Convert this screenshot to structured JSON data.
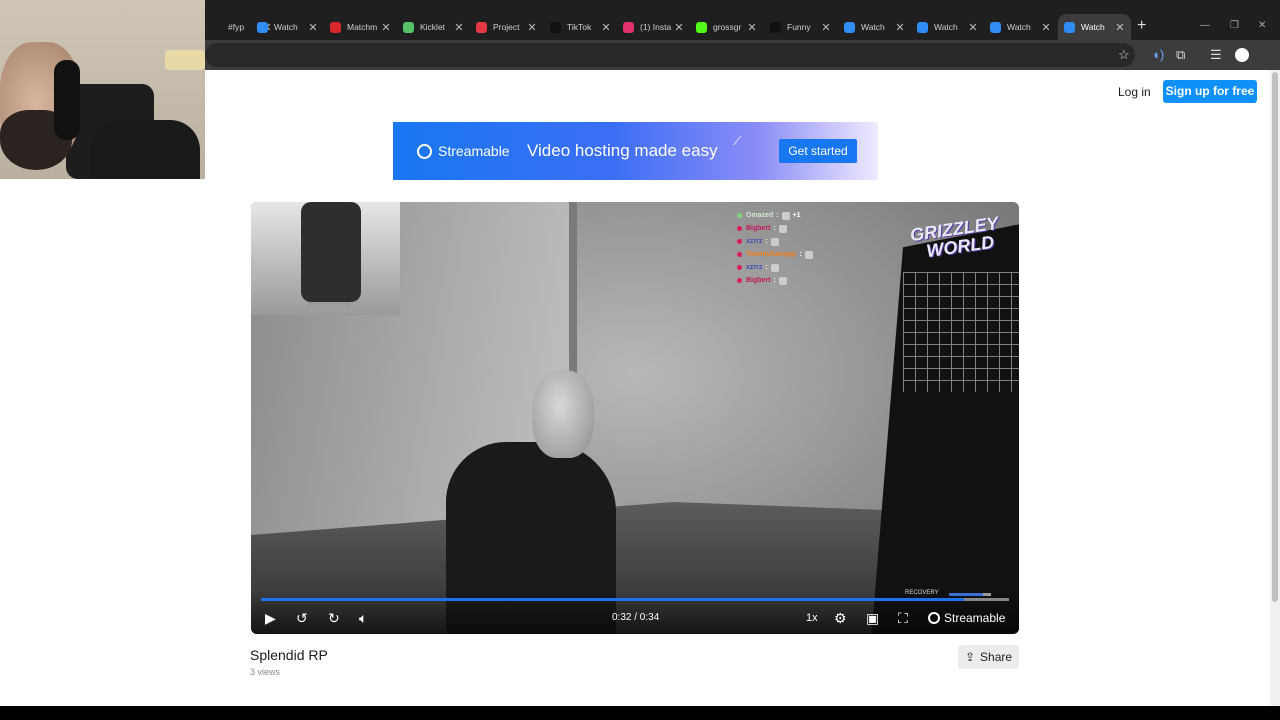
{
  "browser": {
    "tabs": [
      {
        "label": "#fyp",
        "favicon": "#1e1e1e",
        "icon": "tiktok-icon"
      },
      {
        "label": "Watch",
        "favicon": "#2f8df5",
        "icon": "streamable-icon"
      },
      {
        "label": "Matchm",
        "favicon": "#d8262d",
        "icon": "matchmaking-icon"
      },
      {
        "label": "Kicklet",
        "favicon": "#55c26a",
        "icon": "kicklet-icon"
      },
      {
        "label": "Project",
        "favicon": "#e53945",
        "icon": "youtube-icon"
      },
      {
        "label": "TikTok",
        "favicon": "#111111",
        "icon": "tiktok-icon"
      },
      {
        "label": "(1) Insta",
        "favicon": "#e1306c",
        "icon": "instagram-icon"
      },
      {
        "label": "grossgr",
        "favicon": "#53fc18",
        "icon": "kick-icon"
      },
      {
        "label": "Funny",
        "favicon": "#111111",
        "icon": "tiktok-icon"
      },
      {
        "label": "Watch",
        "favicon": "#2f8df5",
        "icon": "streamable-icon"
      },
      {
        "label": "Watch",
        "favicon": "#2f8df5",
        "icon": "streamable-icon"
      },
      {
        "label": "Watch",
        "favicon": "#2f8df5",
        "icon": "streamable-icon"
      },
      {
        "label": "Watch",
        "favicon": "#2f8df5",
        "icon": "streamable-icon",
        "active": true
      }
    ],
    "new_tab": "+",
    "bookmark_icon": "☆",
    "toolbar_icons": [
      "audio-icon",
      "extensions-icon",
      "media-icon",
      "profile-icon"
    ]
  },
  "header": {
    "login_label": "Log in",
    "signup_label": "Sign up for free",
    "accent": "#0f90fa"
  },
  "banner": {
    "brand": "Streamable",
    "tagline": "Video hosting made easy",
    "cta": "Get started"
  },
  "video": {
    "chat": [
      {
        "name": "Omazed",
        "suffix": "+1",
        "color": "#cfe8cf",
        "dot": "#7bd67b"
      },
      {
        "name": "Bigbert",
        "suffix": "",
        "color": "#c2185b",
        "dot": "#d81b60"
      },
      {
        "name": "xzrrz",
        "suffix": "",
        "color": "#3f51b5",
        "dot": "#d81b60"
      },
      {
        "name": "TommySampgr",
        "suffix": "",
        "color": "#ef7d1a",
        "dot": "#d81b60"
      },
      {
        "name": "xzrrz",
        "suffix": "",
        "color": "#3f51b5",
        "dot": "#d81b60"
      },
      {
        "name": "Bigbert",
        "suffix": "",
        "color": "#c2185b",
        "dot": "#d81b60"
      }
    ],
    "overlay_brand_line1": "GRIZZLEY",
    "overlay_brand_line2": "WORLD",
    "recovery_label": "RECOVERY",
    "recovery_level": 0.8,
    "time": "0:32 / 0:34",
    "progress": 0.94,
    "speed": "1x",
    "watermark": "Streamable"
  },
  "details": {
    "title": "Splendid RP",
    "views": "3 views",
    "share_label": "Share"
  }
}
